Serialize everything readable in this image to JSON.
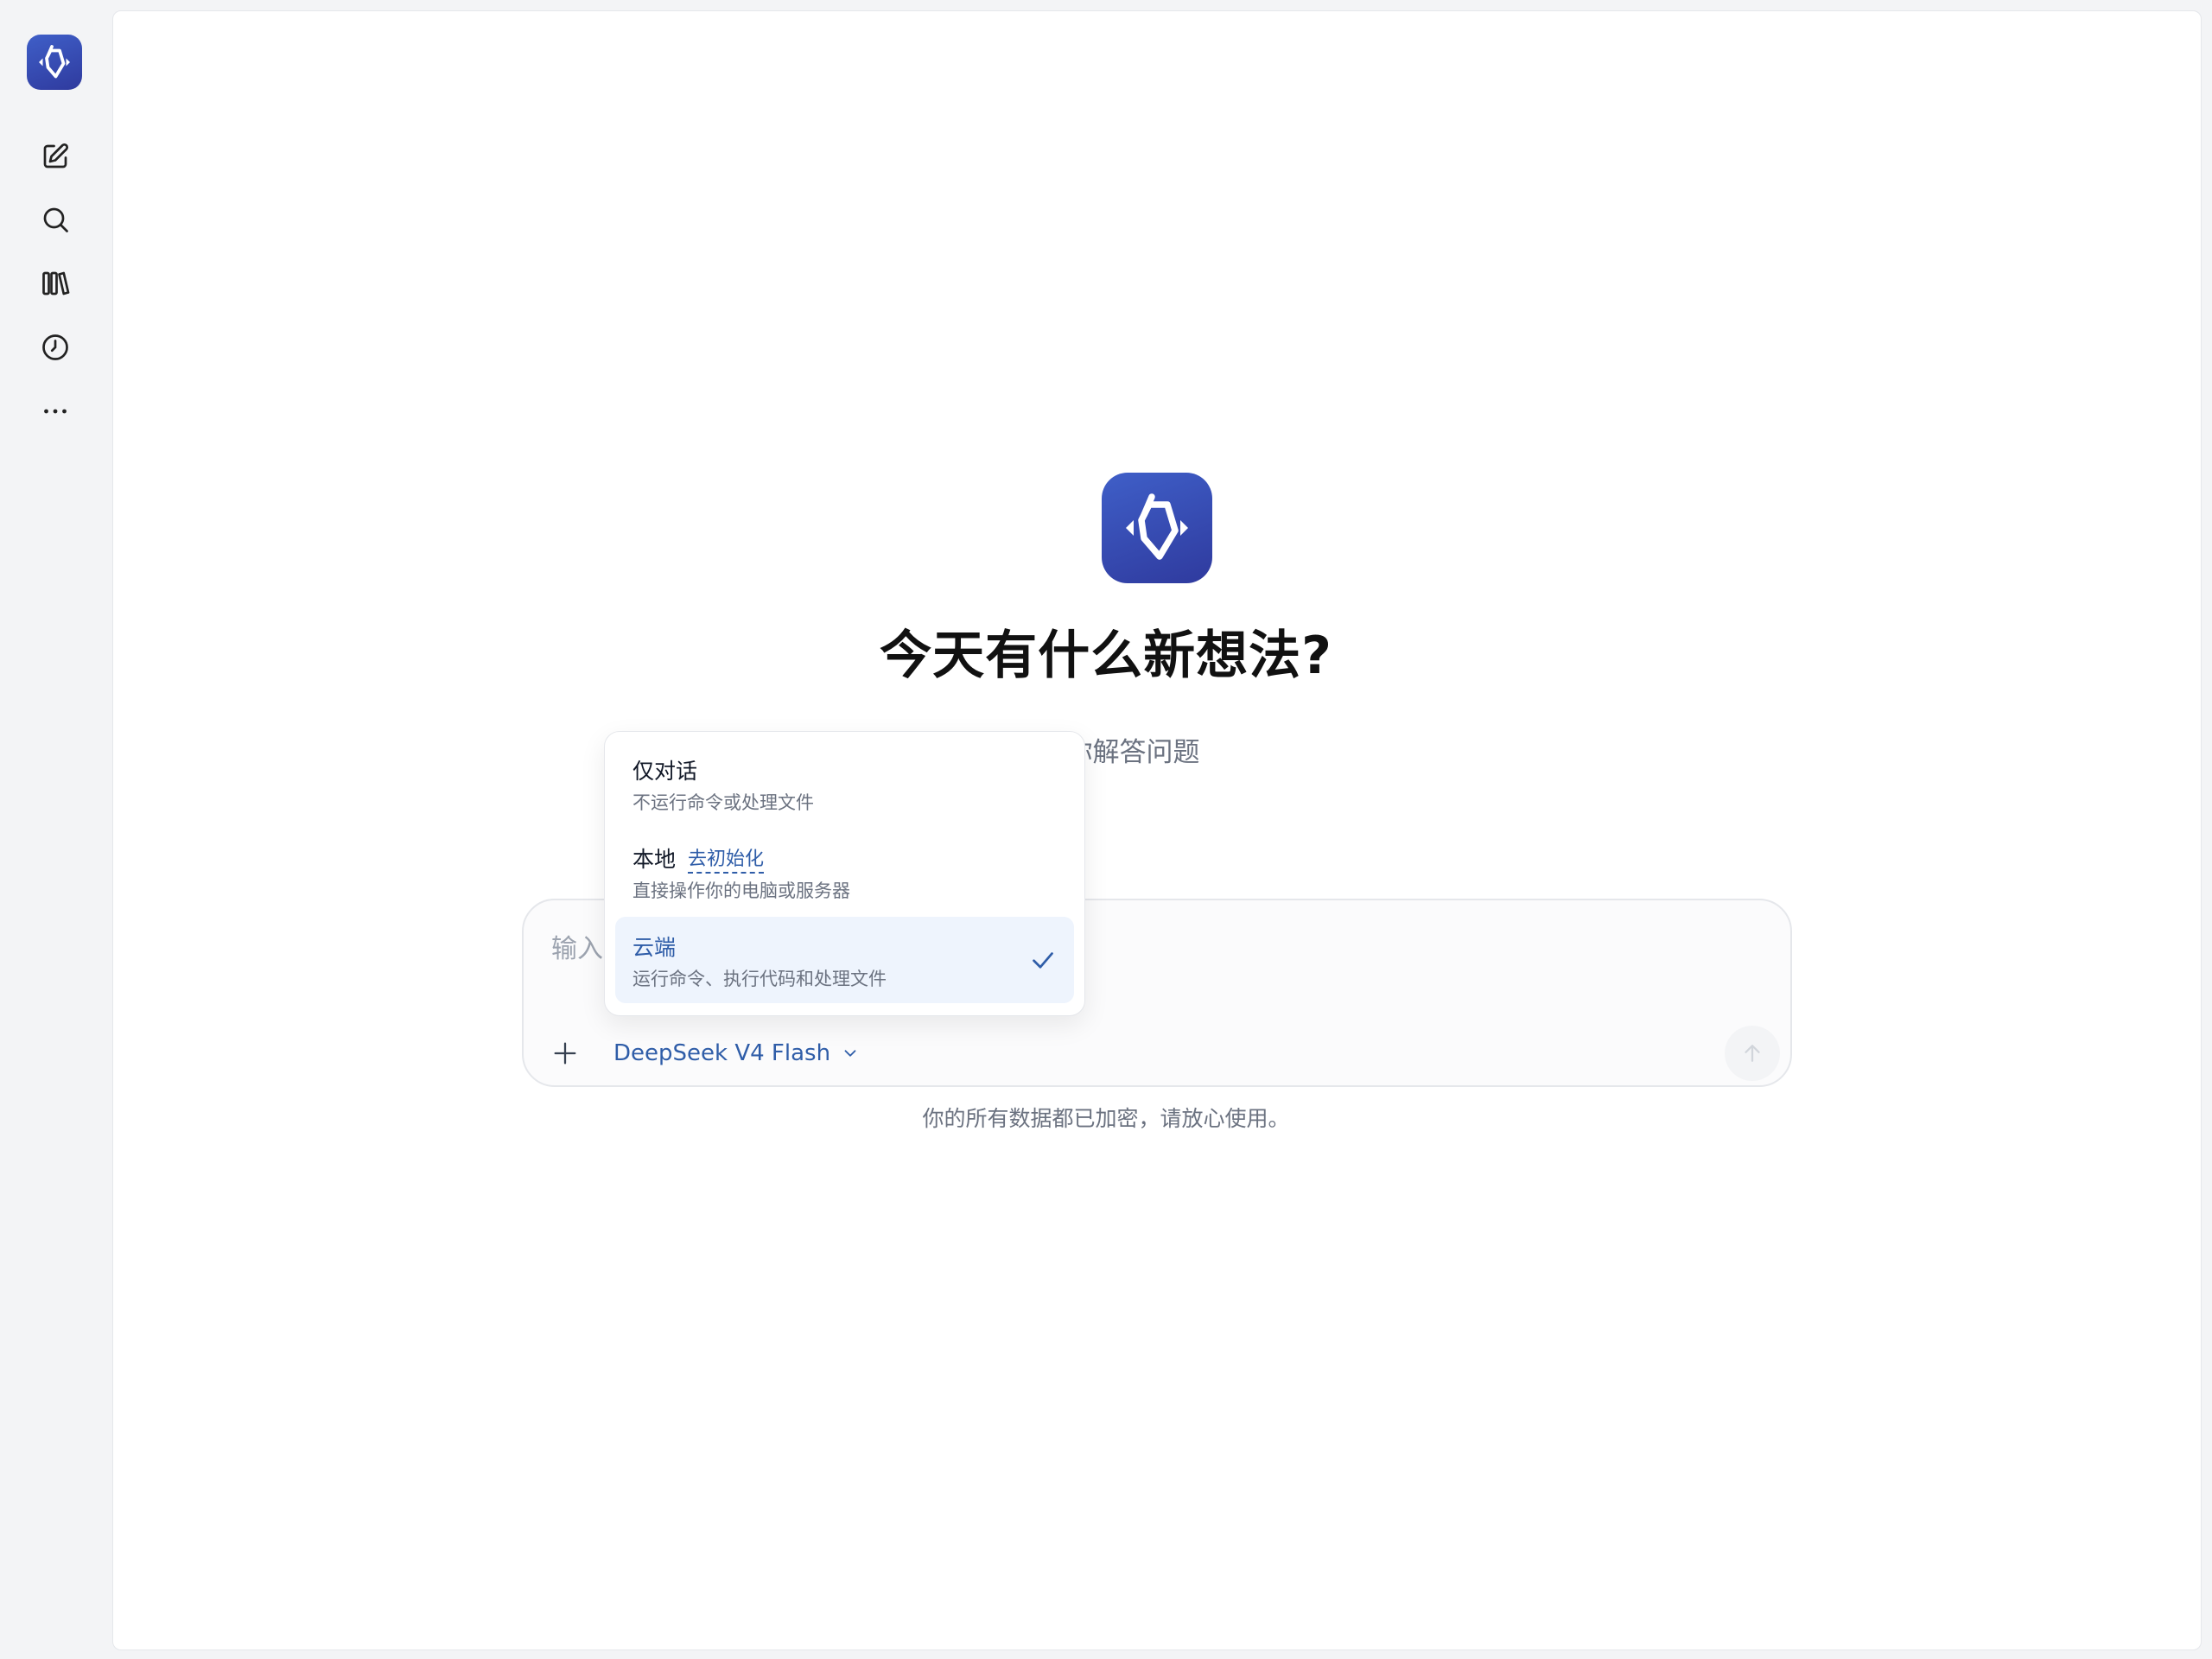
{
  "sidebar": {
    "logo": "app-logo",
    "items": [
      {
        "name": "new-chat",
        "icon": "edit-icon"
      },
      {
        "name": "search",
        "icon": "search-icon"
      },
      {
        "name": "library",
        "icon": "library-icon"
      },
      {
        "name": "history",
        "icon": "clock-icon"
      },
      {
        "name": "more",
        "icon": "more-icon"
      }
    ]
  },
  "hero": {
    "title": "今天有什么新想法?",
    "subtitle": "对为你解答问题"
  },
  "composer": {
    "placeholder": "输入",
    "model_label": "DeepSeek V4 Flash",
    "send_icon": "arrow-up-icon",
    "attach_icon": "plus-icon"
  },
  "mode_menu": {
    "items": [
      {
        "title": "仅对话",
        "description": "不运行命令或处理文件",
        "selected": false
      },
      {
        "title": "本地",
        "link": "去初始化",
        "description": "直接操作你的电脑或服务器",
        "selected": false
      },
      {
        "title": "云端",
        "description": "运行命令、执行代码和处理文件",
        "selected": true
      }
    ]
  },
  "footer": {
    "privacy_note": "你的所有数据都已加密，请放心使用。"
  },
  "colors": {
    "accent": "#2f5da8",
    "logo_gradient_start": "#3f5fc8",
    "logo_gradient_end": "#2f3a9e",
    "selected_bg": "#eef4fd"
  }
}
